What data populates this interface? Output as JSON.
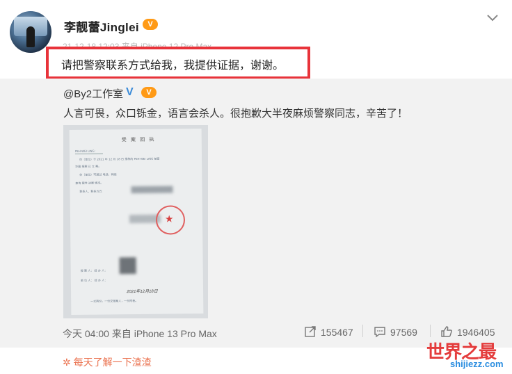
{
  "post": {
    "username": "李靓蕾Jinglei",
    "vip_badge": "V",
    "meta": "21-12-18 12:03 来自 iPhone 12 Pro Max",
    "text": "请把警察联系方式给我，我提供证据，谢谢。"
  },
  "repost": {
    "author": "@By2工作室",
    "verified_mark": "V",
    "vip_badge": "V",
    "text": "人言可畏，众口铄金，语言会杀人。很抱歉大半夜麻烦警察同志，辛苦了！",
    "doc": {
      "title": "受 案 回 执",
      "line1": "PEH-WEI LING:",
      "line2": "你（单位）于 2021 年 12 月 18 日 报称的 PEH-WEI LING 被冒",
      "line3": "诈骗 报案 已 立 案。",
      "line4": "你（单位）可通过 电话、网络",
      "line5": "查询 案件 进展 情况。",
      "line6": "联系人、联系方式",
      "line7": "报 案 人：  经 办 人：",
      "line8": "单 位 人：  经 办 人：",
      "date": "2021年12月18日",
      "bottom": "一式两份，一份交报案人，一份附卷。"
    }
  },
  "footer": {
    "meta": "今天 04:00 来自 iPhone 13 Pro Max",
    "share_count": "155467",
    "comment_count": "97569",
    "like_count": "1946405",
    "link_text": "每天了解一下渣渣"
  },
  "watermark": {
    "title": "世界之最",
    "url": "shijiezz.com"
  },
  "colors": {
    "highlight": "#e8333a",
    "link": "#eb7350",
    "verified": "#3b8bd8",
    "vip": "#ff9a16"
  }
}
